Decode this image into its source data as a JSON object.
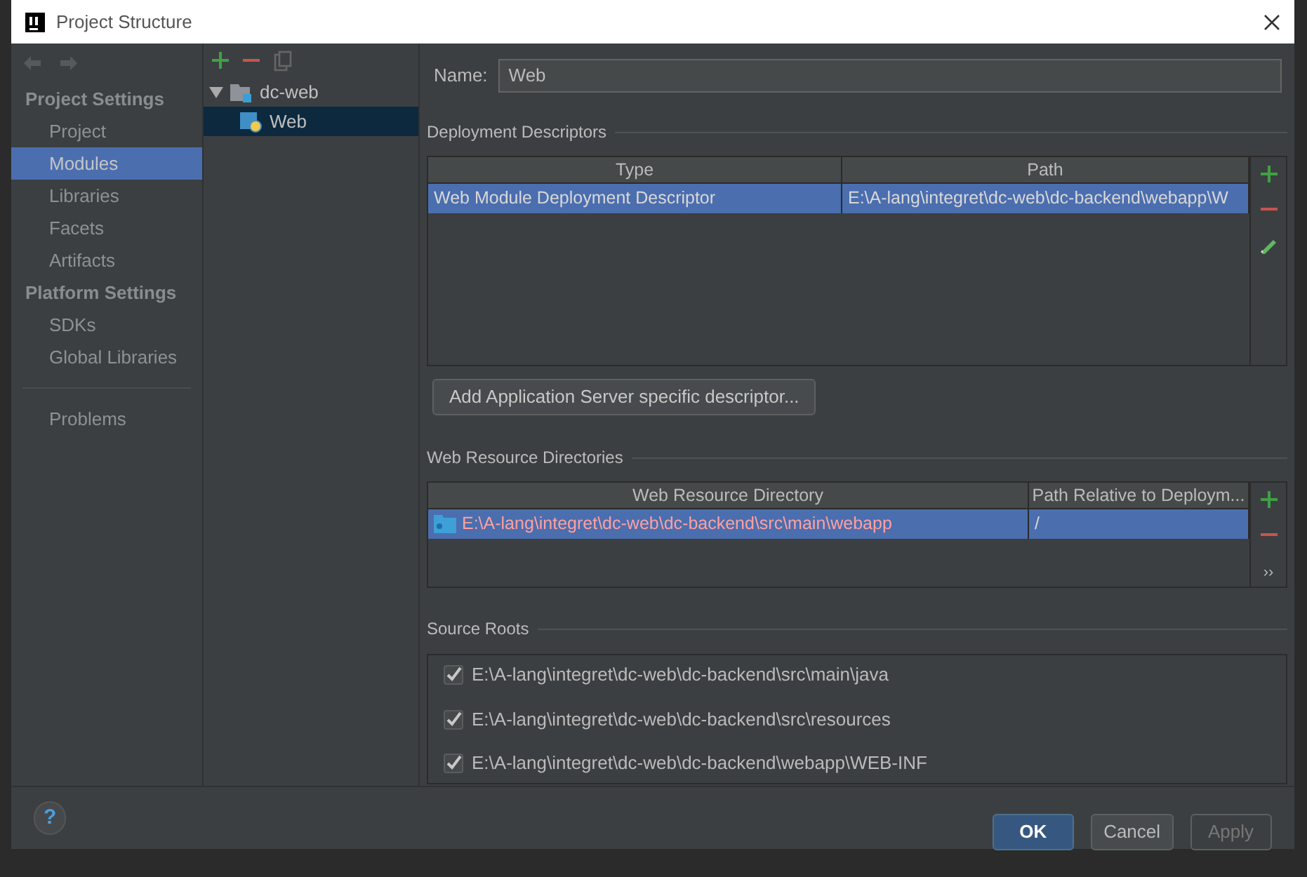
{
  "window": {
    "title": "Project Structure"
  },
  "sidebar": {
    "items": [
      {
        "kind": "header",
        "label": "Project Settings"
      },
      {
        "kind": "item",
        "label": "Project",
        "selected": false
      },
      {
        "kind": "item",
        "label": "Modules",
        "selected": true
      },
      {
        "kind": "item",
        "label": "Libraries",
        "selected": false
      },
      {
        "kind": "item",
        "label": "Facets",
        "selected": false
      },
      {
        "kind": "item",
        "label": "Artifacts",
        "selected": false
      },
      {
        "kind": "header",
        "label": "Platform Settings"
      },
      {
        "kind": "item",
        "label": "SDKs",
        "selected": false
      },
      {
        "kind": "item",
        "label": "Global Libraries",
        "selected": false
      },
      {
        "kind": "separator"
      },
      {
        "kind": "item",
        "label": "Problems",
        "selected": false
      }
    ]
  },
  "tree": [
    {
      "label": "dc-web",
      "expanded": true,
      "selected": false,
      "children": [
        {
          "label": "Web",
          "selected": true
        }
      ]
    }
  ],
  "name_field": {
    "label": "Name:",
    "value": "Web"
  },
  "deployment_descriptors": {
    "title": "Deployment Descriptors",
    "columns": [
      "Type",
      "Path"
    ],
    "rows": [
      {
        "cells": [
          "Web Module Deployment Descriptor",
          "E:\\A-lang\\integret\\dc-web\\dc-backend\\webapp\\W"
        ],
        "selected": true
      }
    ],
    "button": "Add Application Server specific descriptor..."
  },
  "web_resource_directories": {
    "title": "Web Resource Directories",
    "columns": [
      "Web Resource Directory",
      "Path Relative to Deploym..."
    ],
    "rows": [
      {
        "cells": [
          "E:\\A-lang\\integret\\dc-web\\dc-backend\\src\\main\\webapp",
          "/"
        ],
        "selected": true,
        "invalid": true
      }
    ],
    "more": "››"
  },
  "source_roots": {
    "title": "Source Roots",
    "items": [
      {
        "path": "E:\\A-lang\\integret\\dc-web\\dc-backend\\src\\main\\java",
        "checked": true
      },
      {
        "path": "E:\\A-lang\\integret\\dc-web\\dc-backend\\src\\resources",
        "checked": true
      },
      {
        "path": "E:\\A-lang\\integret\\dc-web\\dc-backend\\webapp\\WEB-INF",
        "checked": true
      }
    ]
  },
  "footer": {
    "help": "?",
    "buttons": [
      {
        "label": "OK",
        "kind": "default",
        "disabled": false
      },
      {
        "label": "Cancel",
        "kind": "normal",
        "disabled": false
      },
      {
        "label": "Apply",
        "kind": "normal",
        "disabled": true
      }
    ]
  }
}
